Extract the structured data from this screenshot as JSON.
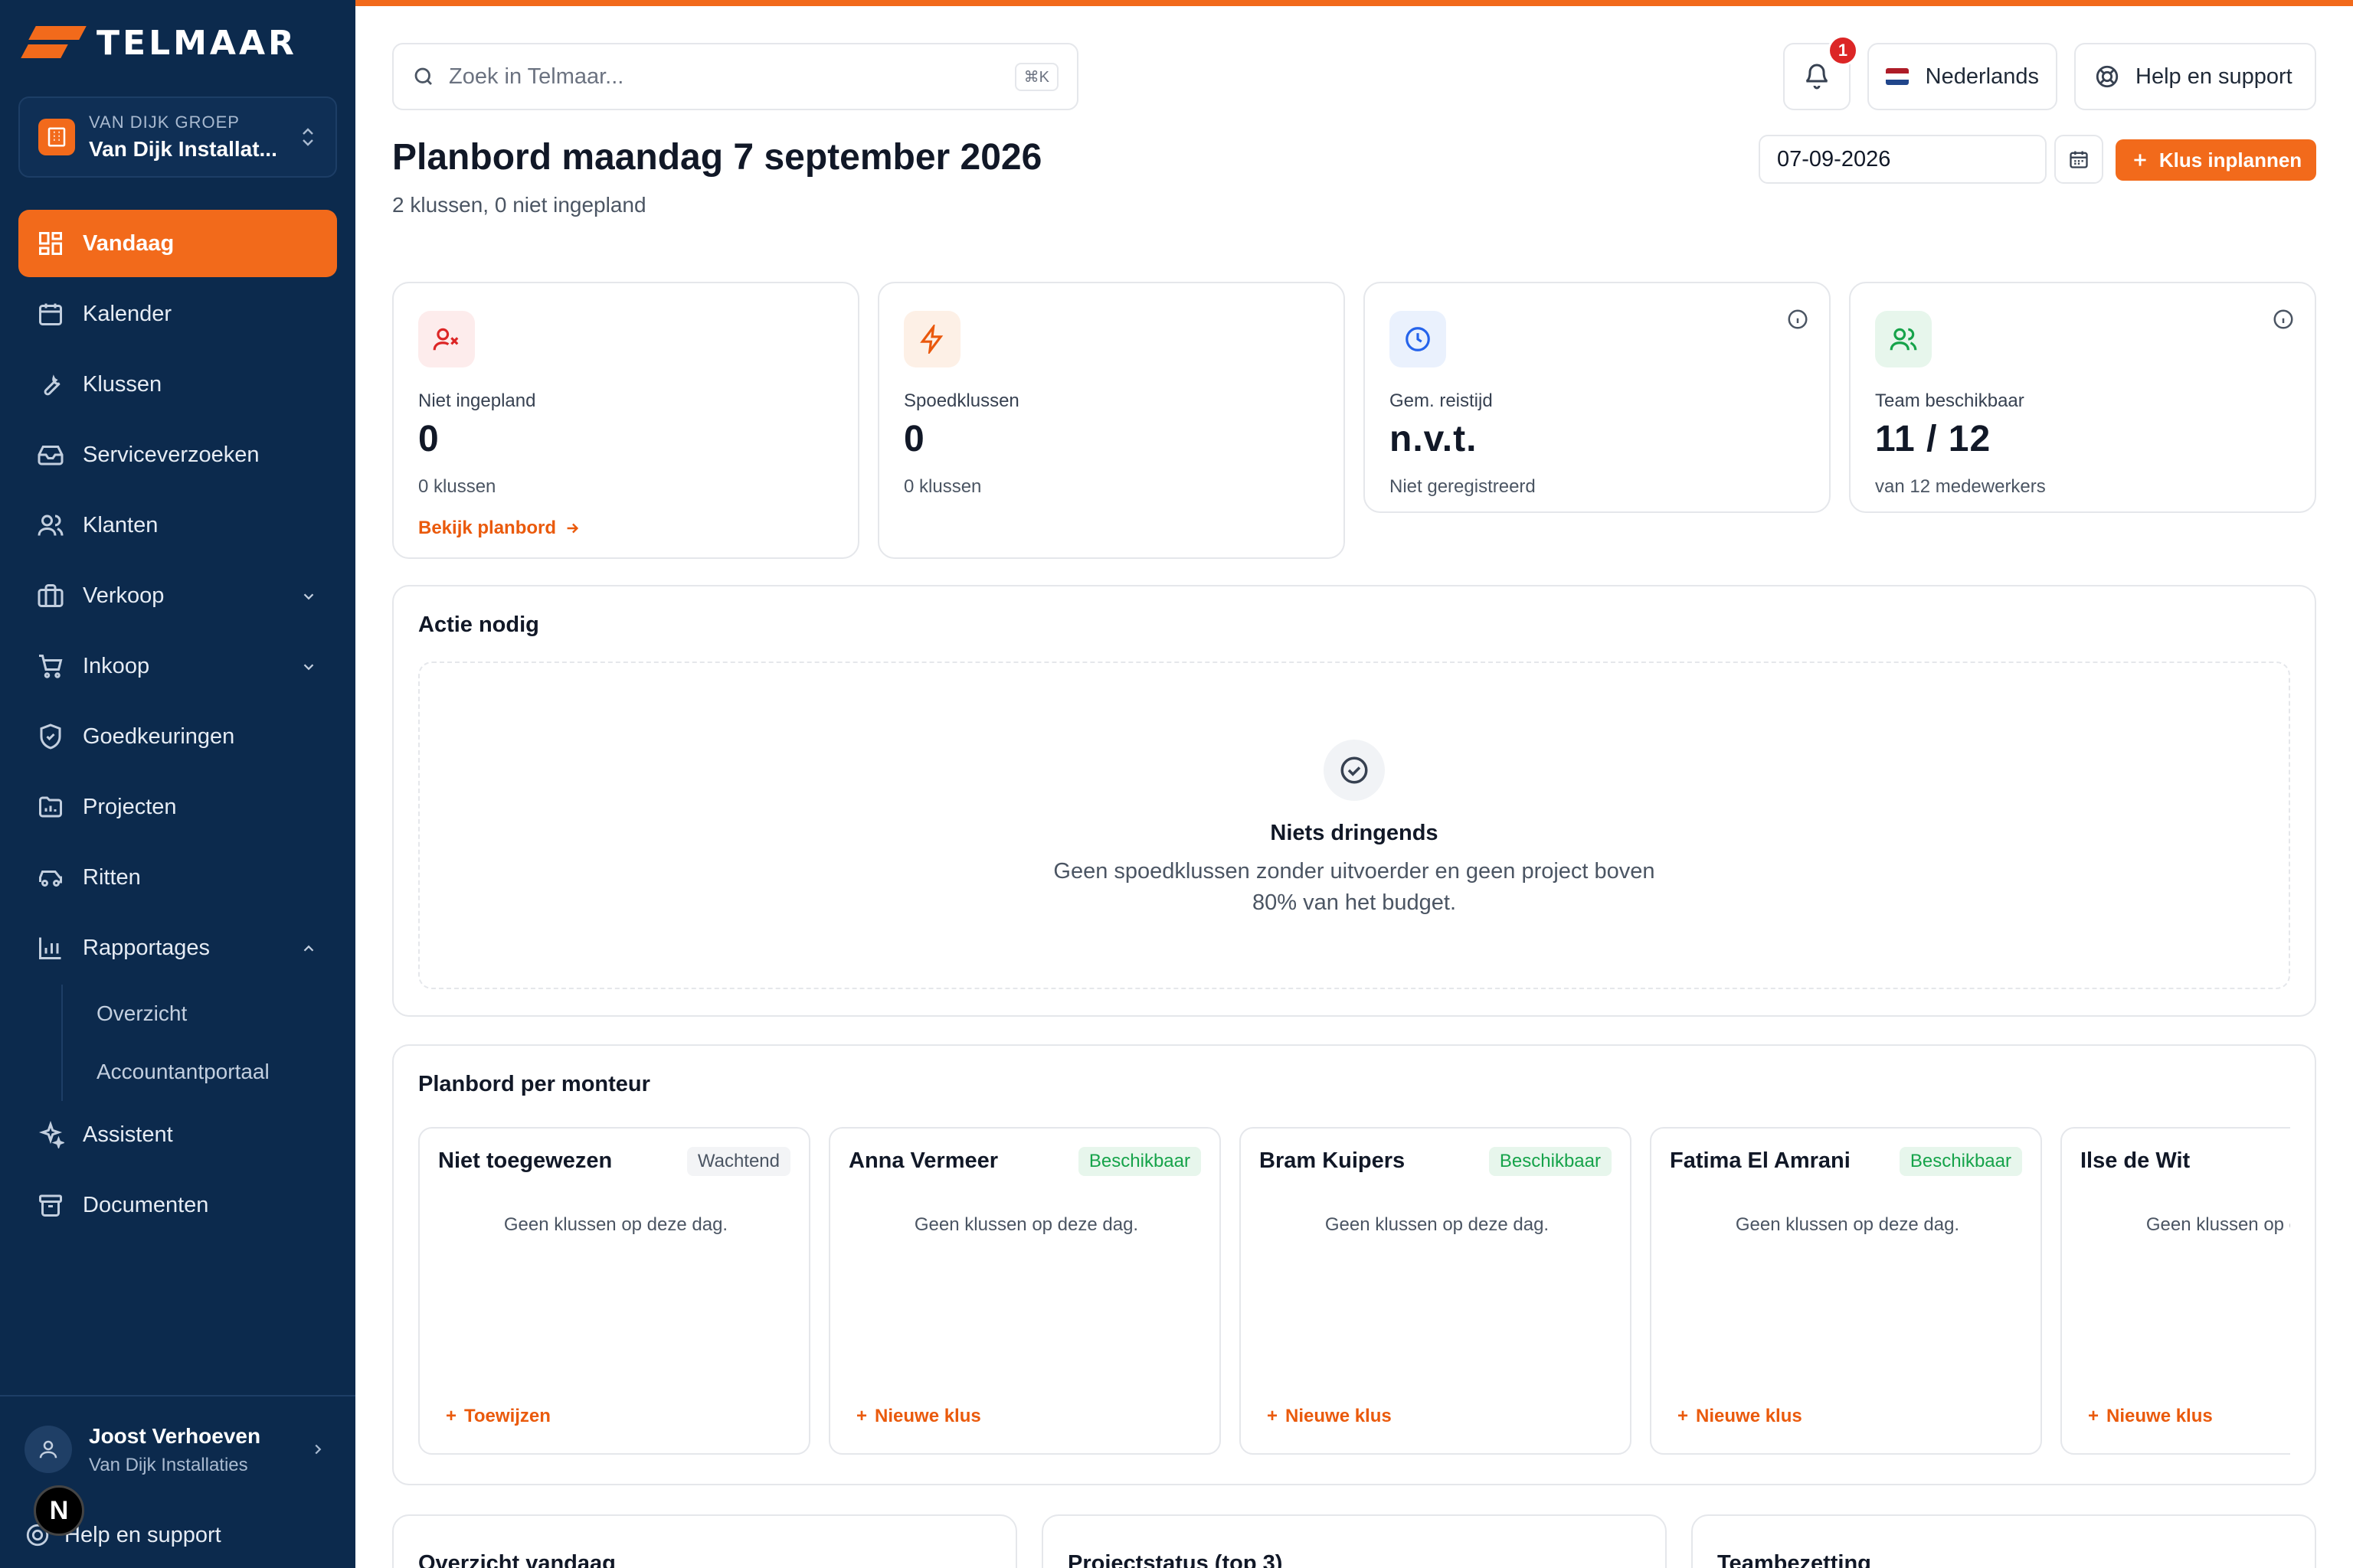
{
  "app": {
    "brand": "TELMAAR"
  },
  "org": {
    "group": "VAN DIJK GROEP",
    "name": "Van Dijk Installat..."
  },
  "nav": {
    "items": [
      {
        "label": "Vandaag",
        "icon": "dashboard-icon",
        "active": true
      },
      {
        "label": "Kalender",
        "icon": "calendar-icon"
      },
      {
        "label": "Klussen",
        "icon": "wrench-icon"
      },
      {
        "label": "Serviceverzoeken",
        "icon": "inbox-icon"
      },
      {
        "label": "Klanten",
        "icon": "users-icon"
      },
      {
        "label": "Verkoop",
        "icon": "briefcase-icon",
        "expandable": true
      },
      {
        "label": "Inkoop",
        "icon": "cart-icon",
        "expandable": true
      },
      {
        "label": "Goedkeuringen",
        "icon": "shield-check-icon"
      },
      {
        "label": "Projecten",
        "icon": "folder-icon"
      },
      {
        "label": "Ritten",
        "icon": "car-icon"
      },
      {
        "label": "Rapportages",
        "icon": "bar-chart-icon",
        "expanded": true
      }
    ],
    "sub_items": [
      "Overzicht",
      "Accountantportaal"
    ],
    "after": [
      {
        "label": "Assistent",
        "icon": "sparkles-icon"
      },
      {
        "label": "Documenten",
        "icon": "archive-icon"
      }
    ]
  },
  "user": {
    "name": "Joost Verhoeven",
    "org": "Van Dijk Installaties",
    "help": "Help en support",
    "n_badge": "N"
  },
  "search": {
    "placeholder": "Zoek in Telmaar...",
    "shortcut": "⌘K"
  },
  "topbar": {
    "notifications": "1",
    "language": "Nederlands",
    "help": "Help en support"
  },
  "header": {
    "title": "Planbord maandag 7 september 2026",
    "subtitle": "2 klussen, 0 niet ingepland",
    "date": "07-09-2026",
    "primary_action": "Klus inplannen"
  },
  "stats": [
    {
      "label": "Niet ingepland",
      "value": "0",
      "note": "0 klussen",
      "link": "Bekijk planbord",
      "icon": "user-x-icon",
      "accent": "#dc2626",
      "bg": "#fdecec"
    },
    {
      "label": "Spoedklussen",
      "value": "0",
      "note": "0 klussen",
      "icon": "lightning-icon",
      "accent": "#ea580c",
      "bg": "#fdf0e6"
    },
    {
      "label": "Gem. reistijd",
      "value": "n.v.t.",
      "note": "Niet geregistreerd",
      "icon": "clock-icon",
      "accent": "#2563eb",
      "bg": "#eaf1fd"
    },
    {
      "label": "Team beschikbaar",
      "value": "11 / 12",
      "note": "van 12 medewerkers",
      "icon": "team-icon",
      "accent": "#16a34a",
      "bg": "#e7f6ec"
    }
  ],
  "action_panel": {
    "title": "Actie nodig",
    "empty_title": "Niets dringends",
    "empty_text": "Geen spoedklussen zonder uitvoerder en geen project boven 80% van het budget."
  },
  "planboard": {
    "title": "Planbord per monteur",
    "columns": [
      {
        "name": "Niet toegewezen",
        "badge": "Wachtend",
        "status": "waiting",
        "empty": "Geen klussen op deze dag.",
        "action": "Toewijzen"
      },
      {
        "name": "Anna Vermeer",
        "badge": "Beschikbaar",
        "status": "ok",
        "empty": "Geen klussen op deze dag.",
        "action": "Nieuwe klus"
      },
      {
        "name": "Bram Kuipers",
        "badge": "Beschikbaar",
        "status": "ok",
        "empty": "Geen klussen op deze dag.",
        "action": "Nieuwe klus"
      },
      {
        "name": "Fatima El Amrani",
        "badge": "Beschikbaar",
        "status": "ok",
        "empty": "Geen klussen op deze dag.",
        "action": "Nieuwe klus"
      },
      {
        "name": "Ilse de Wit",
        "badge": "",
        "status": "ok",
        "empty": "Geen klussen op deze dag.",
        "action": "Nieuwe klus"
      }
    ]
  },
  "bottom_cards": [
    "Overzicht vandaag",
    "Projectstatus (top 3)",
    "Teambezetting"
  ],
  "colors": {
    "brand": "#f26a1b",
    "sidebar": "#0c2a4d"
  }
}
